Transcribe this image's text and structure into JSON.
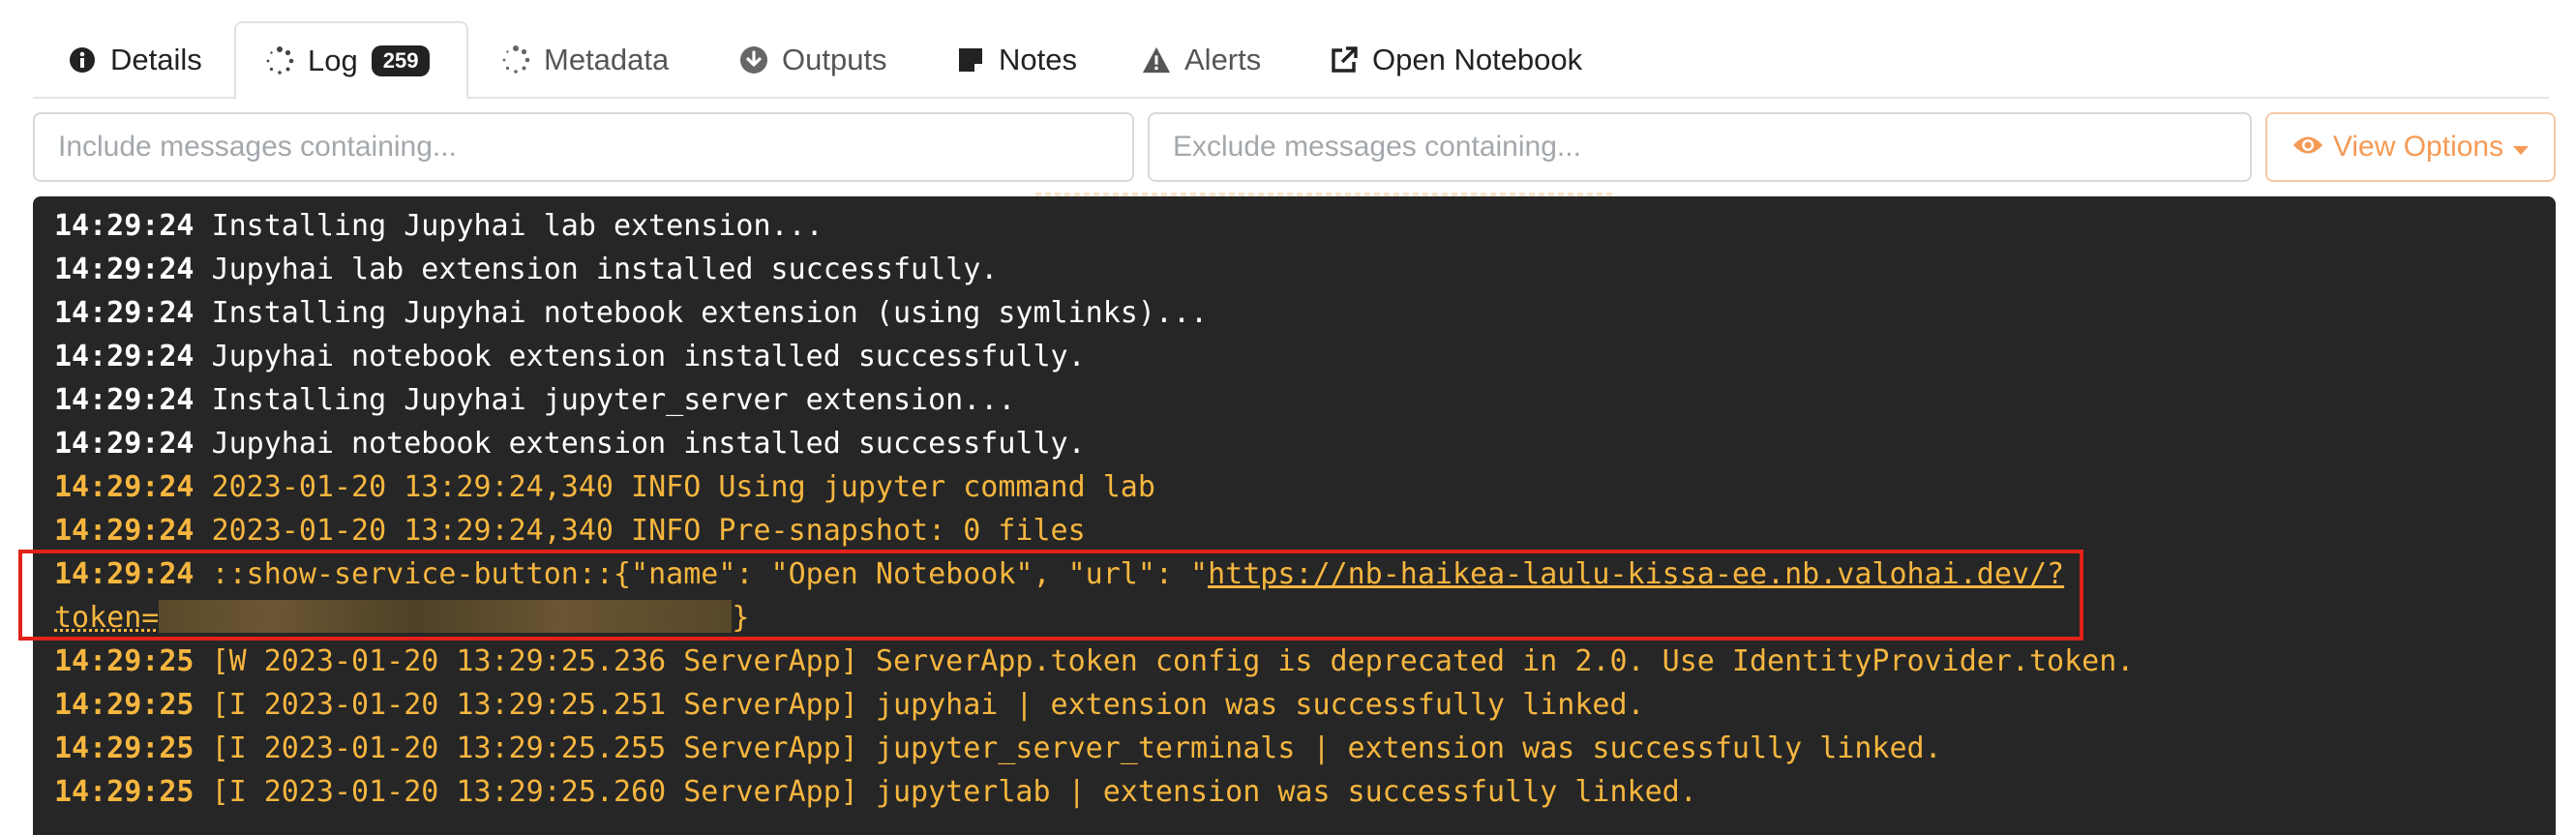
{
  "tabs": [
    {
      "label": "Details",
      "icon": "info-icon"
    },
    {
      "label": "Log",
      "icon": "spinner-icon",
      "badge": "259"
    },
    {
      "label": "Metadata",
      "icon": "spinner-icon"
    },
    {
      "label": "Outputs",
      "icon": "download-circle-icon"
    },
    {
      "label": "Notes",
      "icon": "note-icon"
    },
    {
      "label": "Alerts",
      "icon": "warning-icon"
    },
    {
      "label": "Open Notebook",
      "icon": "external-link-icon"
    }
  ],
  "filters": {
    "include_placeholder": "Include messages containing...",
    "exclude_placeholder": "Exclude messages containing...",
    "view_options_label": "View Options"
  },
  "colors": {
    "accent": "#f59a55",
    "log_background": "#262626",
    "log_warn": "#f6b63f",
    "highlight": "#e2221b"
  },
  "log": {
    "lines": [
      {
        "time": "14:29:24",
        "text": "Installing Jupyhai lab extension..."
      },
      {
        "time": "14:29:24",
        "text": "Jupyhai lab extension installed successfully."
      },
      {
        "time": "14:29:24",
        "text": "Installing Jupyhai notebook extension (using symlinks)..."
      },
      {
        "time": "14:29:24",
        "text": "Jupyhai notebook extension installed successfully."
      },
      {
        "time": "14:29:24",
        "text": "Installing Jupyhai jupyter_server extension..."
      },
      {
        "time": "14:29:24",
        "text": "Jupyhai notebook extension installed successfully."
      },
      {
        "time": "14:29:24",
        "text": "2023-01-20 13:29:24,340 INFO Using jupyter command lab"
      },
      {
        "time": "14:29:24",
        "text": "2023-01-20 13:29:24,340 INFO Pre-snapshot: 0 files"
      }
    ],
    "service_line": {
      "time": "14:29:24",
      "prefix": "::show-service-button::{\"name\": \"Open Notebook\", \"url\": \"",
      "url": "https://nb-haikea-laulu-kissa-ee.nb.valohai.dev/?",
      "token_label": "token=",
      "suffix": "}"
    },
    "lines_after": [
      {
        "time": "14:29:25",
        "text": "[W 2023-01-20 13:29:25.236 ServerApp] ServerApp.token config is deprecated in 2.0. Use IdentityProvider.token."
      },
      {
        "time": "14:29:25",
        "text": "[I 2023-01-20 13:29:25.251 ServerApp] jupyhai | extension was successfully linked."
      },
      {
        "time": "14:29:25",
        "text": "[I 2023-01-20 13:29:25.255 ServerApp] jupyter_server_terminals | extension was successfully linked."
      },
      {
        "time": "14:29:25",
        "text": "[I 2023-01-20 13:29:25.260 ServerApp] jupyterlab | extension was successfully linked."
      }
    ]
  }
}
